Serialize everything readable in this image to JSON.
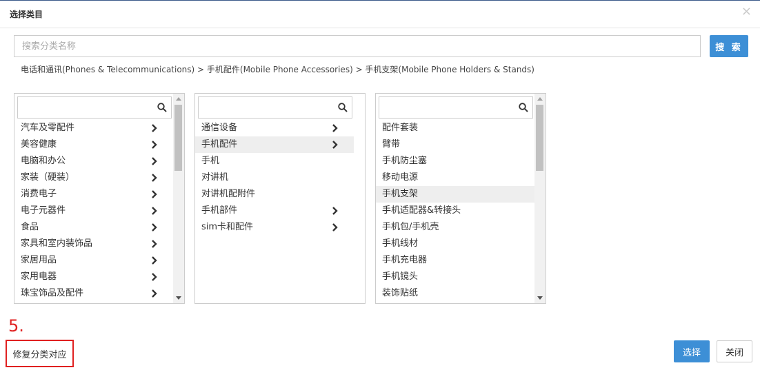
{
  "dialog": {
    "title": "选择类目",
    "close_glyph": "×"
  },
  "search": {
    "placeholder": "搜索分类名称",
    "value": "",
    "button_label": "搜 索"
  },
  "breadcrumb": "电话和通讯(Phones & Telecommunications) > 手机配件(Mobile Phone Accessories) > 手机支架(Mobile Phone Holders & Stands)",
  "columns": [
    {
      "items": [
        {
          "label": "汽车及零配件",
          "has_children": true
        },
        {
          "label": "美容健康",
          "has_children": true
        },
        {
          "label": "电脑和办公",
          "has_children": true
        },
        {
          "label": "家装（硬装）",
          "has_children": true
        },
        {
          "label": "消费电子",
          "has_children": true
        },
        {
          "label": "电子元器件",
          "has_children": true
        },
        {
          "label": "食品",
          "has_children": true
        },
        {
          "label": "家具和室内装饰品",
          "has_children": true
        },
        {
          "label": "家居用品",
          "has_children": true
        },
        {
          "label": "家用电器",
          "has_children": true
        },
        {
          "label": "珠宝饰品及配件",
          "has_children": true
        }
      ]
    },
    {
      "items": [
        {
          "label": "通信设备",
          "has_children": true
        },
        {
          "label": "手机配件",
          "has_children": true,
          "selected": true
        },
        {
          "label": "手机",
          "has_children": false
        },
        {
          "label": "对讲机",
          "has_children": false
        },
        {
          "label": "对讲机配附件",
          "has_children": false
        },
        {
          "label": "手机部件",
          "has_children": true
        },
        {
          "label": "sim卡和配件",
          "has_children": true
        }
      ]
    },
    {
      "items": [
        {
          "label": "配件套装",
          "has_children": false
        },
        {
          "label": "臂带",
          "has_children": false
        },
        {
          "label": "手机防尘塞",
          "has_children": false
        },
        {
          "label": "移动电源",
          "has_children": false
        },
        {
          "label": "手机支架",
          "has_children": false,
          "selected": true
        },
        {
          "label": "手机适配器&转接头",
          "has_children": false
        },
        {
          "label": "手机包/手机壳",
          "has_children": false
        },
        {
          "label": "手机线材",
          "has_children": false
        },
        {
          "label": "手机充电器",
          "has_children": false
        },
        {
          "label": "手机镜头",
          "has_children": false
        },
        {
          "label": "装饰贴纸",
          "has_children": false
        }
      ]
    }
  ],
  "annotation": {
    "step_number": "5.",
    "highlight_color": "#e02020"
  },
  "footer": {
    "fix_button_label": "修复分类对应",
    "select_button_label": "选择",
    "close_button_label": "关闭"
  },
  "colors": {
    "primary": "#3d8fd6",
    "selected_row": "#eeeeee"
  },
  "icons": {
    "column_search": "magnifier-icon",
    "child_indicator": "chevron-right-icon"
  }
}
